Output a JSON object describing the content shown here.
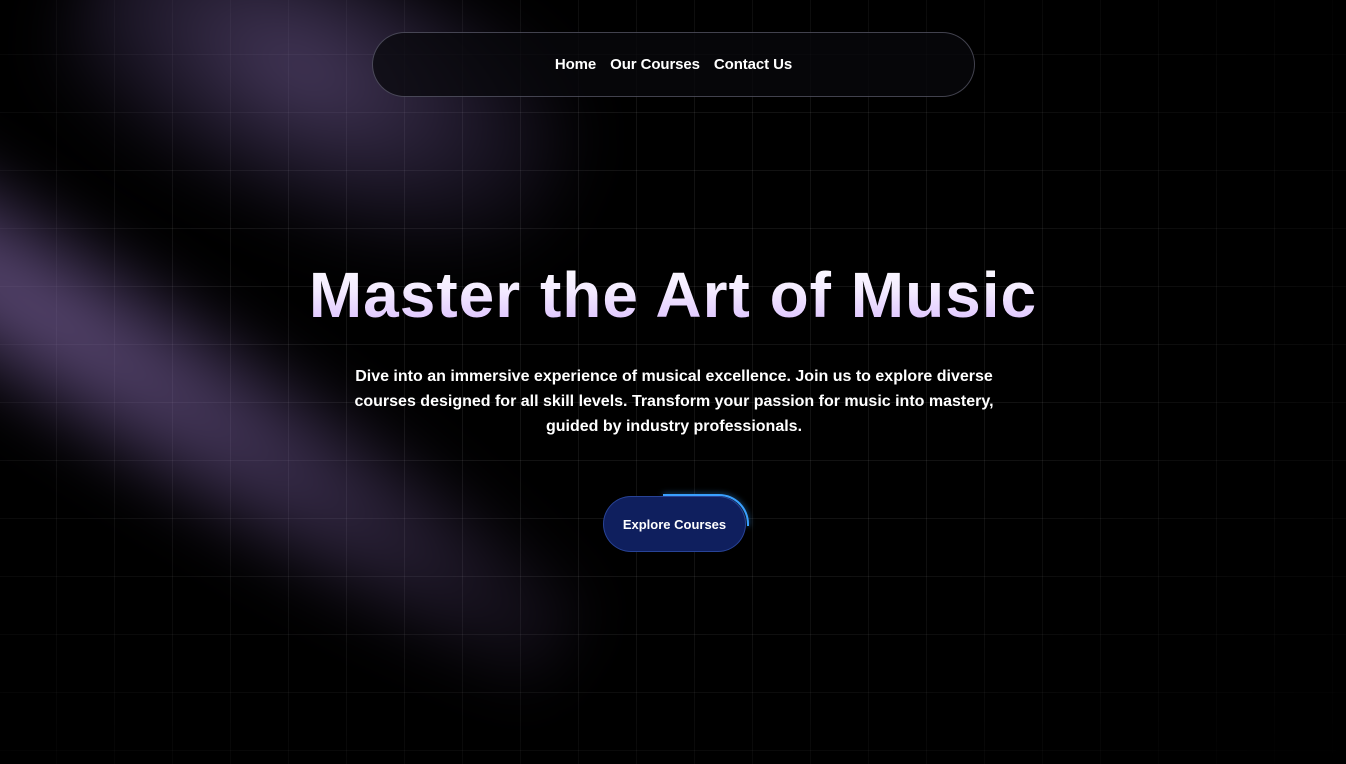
{
  "nav": {
    "items": [
      {
        "label": "Home"
      },
      {
        "label": "Our Courses"
      },
      {
        "label": "Contact Us"
      }
    ]
  },
  "hero": {
    "title": "Master the Art of Music",
    "description": "Dive into an immersive experience of musical excellence. Join us to explore diverse courses designed for all skill levels. Transform your passion for music into mastery, guided by industry professionals.",
    "cta_label": "Explore Courses"
  },
  "colors": {
    "background": "#000000",
    "beam": "#8a72b0",
    "title_gradient_end": "#d8b8ff",
    "cta_background": "#0f1f5e",
    "cta_accent": "#3aa0ff"
  }
}
